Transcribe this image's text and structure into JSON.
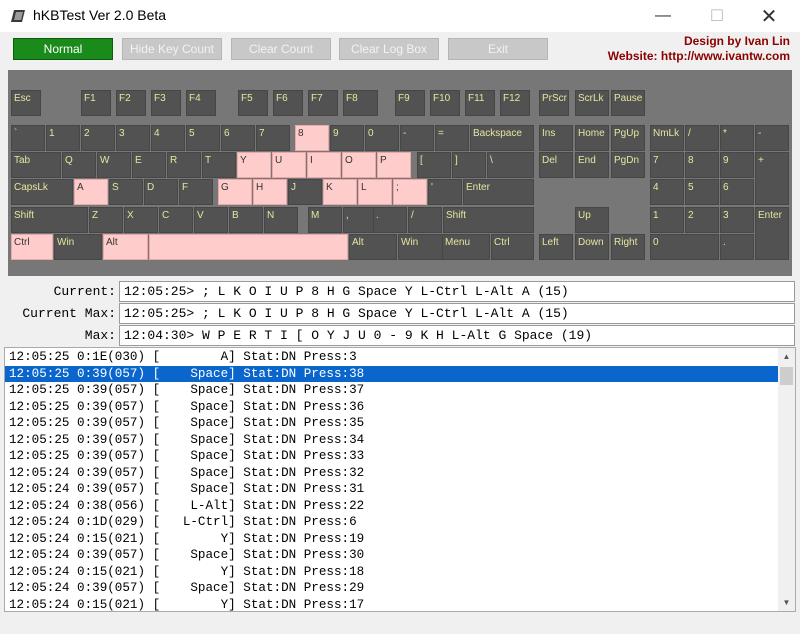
{
  "window": {
    "title": "hKBTest Ver 2.0 Beta",
    "minimize_icon": "minimize-icon",
    "maximize_icon": "maximize-icon",
    "close_icon": "close-icon",
    "minimize_glyph": "—",
    "maximize_glyph": "☐",
    "close_glyph": "✕"
  },
  "toolbar": {
    "normal": "Normal",
    "hide_key_count": "Hide Key Count",
    "clear_count": "Clear Count",
    "clear_log_box": "Clear Log Box",
    "exit": "Exit"
  },
  "credit": {
    "line1": "Design by Ivan Lin",
    "line2": "Website: http://www.ivantw.com"
  },
  "colors": {
    "key_normal": "#525252",
    "key_pressed": "#ffcccc",
    "key_label": "#e6e6a0",
    "keyboard_bg": "#777777",
    "normal_button": "#1a8a1a",
    "selected_row": "#0a66cc",
    "credit_text": "#8b0000"
  },
  "keyboard": {
    "keys": [
      {
        "id": "esc",
        "label": "Esc",
        "pressed": false
      },
      {
        "id": "f1",
        "label": "F1",
        "pressed": false
      },
      {
        "id": "f2",
        "label": "F2",
        "pressed": false
      },
      {
        "id": "f3",
        "label": "F3",
        "pressed": false
      },
      {
        "id": "f4",
        "label": "F4",
        "pressed": false
      },
      {
        "id": "f5",
        "label": "F5",
        "pressed": false
      },
      {
        "id": "f6",
        "label": "F6",
        "pressed": false
      },
      {
        "id": "f7",
        "label": "F7",
        "pressed": false
      },
      {
        "id": "f8",
        "label": "F8",
        "pressed": false
      },
      {
        "id": "f9",
        "label": "F9",
        "pressed": false
      },
      {
        "id": "f10",
        "label": "F10",
        "pressed": false
      },
      {
        "id": "f11",
        "label": "F11",
        "pressed": false
      },
      {
        "id": "f12",
        "label": "F12",
        "pressed": false
      },
      {
        "id": "prscr",
        "label": "PrScr",
        "pressed": false
      },
      {
        "id": "scrlk",
        "label": "ScrLk",
        "pressed": false
      },
      {
        "id": "pause",
        "label": "Pause",
        "pressed": false
      },
      {
        "id": "backtick",
        "label": "`",
        "pressed": false
      },
      {
        "id": "d1",
        "label": "1",
        "pressed": false
      },
      {
        "id": "d2",
        "label": "2",
        "pressed": false
      },
      {
        "id": "d3",
        "label": "3",
        "pressed": false
      },
      {
        "id": "d4",
        "label": "4",
        "pressed": false
      },
      {
        "id": "d5",
        "label": "5",
        "pressed": false
      },
      {
        "id": "d6",
        "label": "6",
        "pressed": false
      },
      {
        "id": "d7",
        "label": "7",
        "pressed": false
      },
      {
        "id": "d8",
        "label": "8",
        "pressed": true
      },
      {
        "id": "d9",
        "label": "9",
        "pressed": false
      },
      {
        "id": "d0",
        "label": "0",
        "pressed": false
      },
      {
        "id": "minus",
        "label": "-",
        "pressed": false
      },
      {
        "id": "equal",
        "label": "=",
        "pressed": false
      },
      {
        "id": "backspace",
        "label": "Backspace",
        "pressed": false
      },
      {
        "id": "ins",
        "label": "Ins",
        "pressed": false
      },
      {
        "id": "home",
        "label": "Home",
        "pressed": false
      },
      {
        "id": "pgup",
        "label": "PgUp",
        "pressed": false
      },
      {
        "id": "nmlk",
        "label": "NmLk",
        "pressed": false
      },
      {
        "id": "numdiv",
        "label": "/",
        "pressed": false
      },
      {
        "id": "nummul",
        "label": "*",
        "pressed": false
      },
      {
        "id": "numsub",
        "label": "-",
        "pressed": false
      },
      {
        "id": "tab",
        "label": "Tab",
        "pressed": false
      },
      {
        "id": "q",
        "label": "Q",
        "pressed": false
      },
      {
        "id": "w",
        "label": "W",
        "pressed": false
      },
      {
        "id": "e",
        "label": "E",
        "pressed": false
      },
      {
        "id": "r",
        "label": "R",
        "pressed": false
      },
      {
        "id": "t",
        "label": "T",
        "pressed": false
      },
      {
        "id": "y",
        "label": "Y",
        "pressed": true
      },
      {
        "id": "u",
        "label": "U",
        "pressed": true
      },
      {
        "id": "i",
        "label": "I",
        "pressed": true
      },
      {
        "id": "o",
        "label": "O",
        "pressed": true
      },
      {
        "id": "p",
        "label": "P",
        "pressed": true
      },
      {
        "id": "lbracket",
        "label": "[",
        "pressed": false
      },
      {
        "id": "rbracket",
        "label": "]",
        "pressed": false
      },
      {
        "id": "backslash",
        "label": "\\",
        "pressed": false
      },
      {
        "id": "del",
        "label": "Del",
        "pressed": false
      },
      {
        "id": "end",
        "label": "End",
        "pressed": false
      },
      {
        "id": "pgdn",
        "label": "PgDn",
        "pressed": false
      },
      {
        "id": "num7",
        "label": "7",
        "pressed": false
      },
      {
        "id": "num8",
        "label": "8",
        "pressed": false
      },
      {
        "id": "num9",
        "label": "9",
        "pressed": false
      },
      {
        "id": "numadd",
        "label": "+",
        "pressed": false
      },
      {
        "id": "capslk",
        "label": "CapsLk",
        "pressed": false
      },
      {
        "id": "a",
        "label": "A",
        "pressed": true
      },
      {
        "id": "s",
        "label": "S",
        "pressed": false
      },
      {
        "id": "d",
        "label": "D",
        "pressed": false
      },
      {
        "id": "f",
        "label": "F",
        "pressed": false
      },
      {
        "id": "g",
        "label": "G",
        "pressed": true
      },
      {
        "id": "h",
        "label": "H",
        "pressed": true
      },
      {
        "id": "j",
        "label": "J",
        "pressed": false
      },
      {
        "id": "k",
        "label": "K",
        "pressed": true
      },
      {
        "id": "l",
        "label": "L",
        "pressed": true
      },
      {
        "id": "semicolon",
        "label": ";",
        "pressed": true
      },
      {
        "id": "quote",
        "label": "'",
        "pressed": false
      },
      {
        "id": "enter",
        "label": "Enter",
        "pressed": false
      },
      {
        "id": "num4",
        "label": "4",
        "pressed": false
      },
      {
        "id": "num5",
        "label": "5",
        "pressed": false
      },
      {
        "id": "num6",
        "label": "6",
        "pressed": false
      },
      {
        "id": "lshift",
        "label": "Shift",
        "pressed": false
      },
      {
        "id": "z",
        "label": "Z",
        "pressed": false
      },
      {
        "id": "x",
        "label": "X",
        "pressed": false
      },
      {
        "id": "c",
        "label": "C",
        "pressed": false
      },
      {
        "id": "v",
        "label": "V",
        "pressed": false
      },
      {
        "id": "b",
        "label": "B",
        "pressed": false
      },
      {
        "id": "n",
        "label": "N",
        "pressed": false
      },
      {
        "id": "m",
        "label": "M",
        "pressed": false
      },
      {
        "id": "comma",
        "label": ",",
        "pressed": false
      },
      {
        "id": "period",
        "label": ".",
        "pressed": false
      },
      {
        "id": "slash",
        "label": "/",
        "pressed": false
      },
      {
        "id": "rshift",
        "label": "Shift",
        "pressed": false
      },
      {
        "id": "up",
        "label": "Up",
        "pressed": false
      },
      {
        "id": "num1",
        "label": "1",
        "pressed": false
      },
      {
        "id": "num2",
        "label": "2",
        "pressed": false
      },
      {
        "id": "num3",
        "label": "3",
        "pressed": false
      },
      {
        "id": "numenter",
        "label": "Enter",
        "pressed": false
      },
      {
        "id": "lctrl",
        "label": "Ctrl",
        "pressed": true
      },
      {
        "id": "lwin",
        "label": "Win",
        "pressed": false
      },
      {
        "id": "lalt",
        "label": "Alt",
        "pressed": true
      },
      {
        "id": "space",
        "label": "",
        "pressed": true
      },
      {
        "id": "ralt",
        "label": "Alt",
        "pressed": false
      },
      {
        "id": "rwin",
        "label": "Win",
        "pressed": false
      },
      {
        "id": "menu",
        "label": "Menu",
        "pressed": false
      },
      {
        "id": "rctrl",
        "label": "Ctrl",
        "pressed": false
      },
      {
        "id": "left",
        "label": "Left",
        "pressed": false
      },
      {
        "id": "down",
        "label": "Down",
        "pressed": false
      },
      {
        "id": "right",
        "label": "Right",
        "pressed": false
      },
      {
        "id": "num0",
        "label": "0",
        "pressed": false
      },
      {
        "id": "numdot",
        "label": ".",
        "pressed": false
      }
    ]
  },
  "info": {
    "current_label": "Current:",
    "current_value": "12:05:25> ; L K O I U P 8 H G Space Y L-Ctrl L-Alt A (15)",
    "current_max_label": "Current Max:",
    "current_max_value": "12:05:25> ; L K O I U P 8 H G Space Y L-Ctrl L-Alt A (15)",
    "max_label": "Max:",
    "max_value": "12:04:30> W P E R T I [ O Y J U 0 - 9 K H L-Alt G Space (19)"
  },
  "log": {
    "rows": [
      "12:05:25 0:1E(030) [        A] Stat:DN Press:3",
      "12:05:25 0:39(057) [    Space] Stat:DN Press:38",
      "12:05:25 0:39(057) [    Space] Stat:DN Press:37",
      "12:05:25 0:39(057) [    Space] Stat:DN Press:36",
      "12:05:25 0:39(057) [    Space] Stat:DN Press:35",
      "12:05:25 0:39(057) [    Space] Stat:DN Press:34",
      "12:05:25 0:39(057) [    Space] Stat:DN Press:33",
      "12:05:24 0:39(057) [    Space] Stat:DN Press:32",
      "12:05:24 0:39(057) [    Space] Stat:DN Press:31",
      "12:05:24 0:38(056) [    L-Alt] Stat:DN Press:22",
      "12:05:24 0:1D(029) [   L-Ctrl] Stat:DN Press:6",
      "12:05:24 0:15(021) [        Y] Stat:DN Press:19",
      "12:05:24 0:39(057) [    Space] Stat:DN Press:30",
      "12:05:24 0:15(021) [        Y] Stat:DN Press:18",
      "12:05:24 0:39(057) [    Space] Stat:DN Press:29",
      "12:05:24 0:15(021) [        Y] Stat:DN Press:17"
    ],
    "selected_index": 1,
    "scroll_up_icon": "scroll-up-arrow-icon",
    "scroll_down_icon": "scroll-down-arrow-icon",
    "up_glyph": "▲",
    "down_glyph": "▼"
  }
}
